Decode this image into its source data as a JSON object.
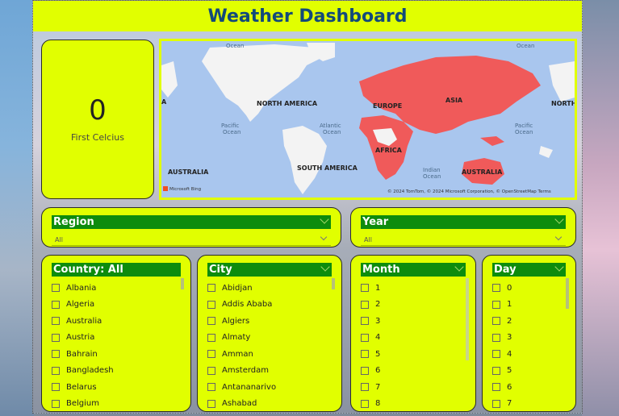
{
  "header": {
    "title": "Weather Dashboard"
  },
  "kpi": {
    "value": "0",
    "label": "First Celcius"
  },
  "map": {
    "labels": {
      "north_america_left": "NORTH AMERICA",
      "north_america_right": "NORTH",
      "south_america": "SOUTH AMERICA",
      "europe": "EUROPE",
      "asia": "ASIA",
      "africa": "AFRICA",
      "australia_left": "AUSTRALIA",
      "australia_right": "AUSTRALIA",
      "a_left": "A",
      "pacific_left": "Pacific",
      "ocean_pacific_left": "Ocean",
      "atlantic": "Atlantic",
      "ocean_atlantic": "Ocean",
      "pacific_right": "Pacific",
      "ocean_pacific_right": "Ocean",
      "indian": "Indian",
      "ocean_indian": "Ocean",
      "ocean_top_left": "Ocean",
      "ocean_top_right": "Ocean"
    },
    "attribution": "© 2024 TomTom, © 2024 Microsoft Corporation, © OpenStreetMap  Terms",
    "bing": "Microsoft Bing",
    "colors": {
      "water": "#a9c6ee",
      "land": "#f3f3f3",
      "highlight": "#f05a5a"
    }
  },
  "slicers": {
    "region": {
      "title": "Region",
      "value": "All"
    },
    "year": {
      "title": "Year",
      "value": "All"
    },
    "country": {
      "title": "Country: All",
      "items": [
        "Albania",
        "Algeria",
        "Australia",
        "Austria",
        "Bahrain",
        "Bangladesh",
        "Belarus",
        "Belgium"
      ]
    },
    "city": {
      "title": "City",
      "items": [
        "Abidjan",
        "Addis Ababa",
        "Algiers",
        "Almaty",
        "Amman",
        "Amsterdam",
        "Antananarivo",
        "Ashabad"
      ]
    },
    "month": {
      "title": "Month",
      "items": [
        "1",
        "2",
        "3",
        "4",
        "5",
        "6",
        "7",
        "8"
      ]
    },
    "day": {
      "title": "Day",
      "items": [
        "0",
        "1",
        "2",
        "3",
        "4",
        "5",
        "6",
        "7"
      ]
    }
  },
  "colors": {
    "accent": "#e1ff00",
    "header_green": "#0d8c0d",
    "title": "#134a7a"
  }
}
